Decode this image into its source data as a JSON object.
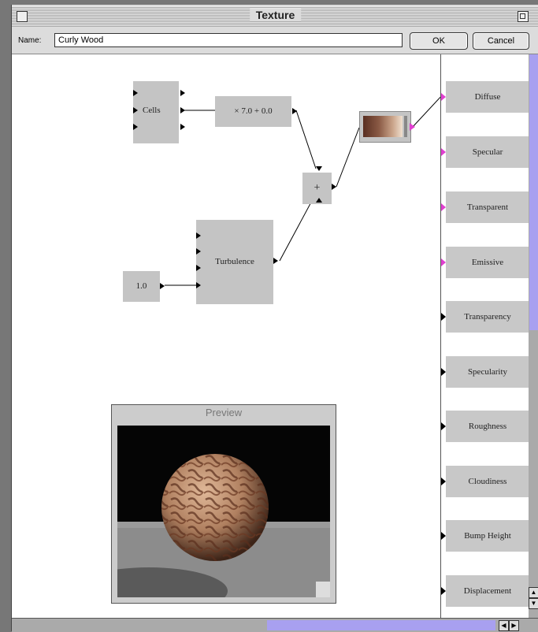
{
  "window": {
    "title": "Texture"
  },
  "name_field": {
    "label": "Name:",
    "value": "Curly Wood"
  },
  "buttons": {
    "ok": "OK",
    "cancel": "Cancel"
  },
  "nodes": {
    "cells": "Cells",
    "scale": "× 7.0 + 0.0",
    "add": "+",
    "turbulence": "Turbulence",
    "constant": "1.0"
  },
  "preview": {
    "title": "Preview"
  },
  "output_ports": [
    {
      "label": "Diffuse",
      "connector": "pink"
    },
    {
      "label": "Specular",
      "connector": "pink"
    },
    {
      "label": "Transparent",
      "connector": "pink"
    },
    {
      "label": "Emissive",
      "connector": "pink"
    },
    {
      "label": "Transparency",
      "connector": "black"
    },
    {
      "label": "Specularity",
      "connector": "black"
    },
    {
      "label": "Roughness",
      "connector": "black"
    },
    {
      "label": "Cloudiness",
      "connector": "black"
    },
    {
      "label": "Bump Height",
      "connector": "black"
    },
    {
      "label": "Displacement",
      "connector": "black"
    }
  ],
  "colors": {
    "scrollbar_thumb": "#a8a0f0",
    "connector_pink": "#e040d0"
  }
}
